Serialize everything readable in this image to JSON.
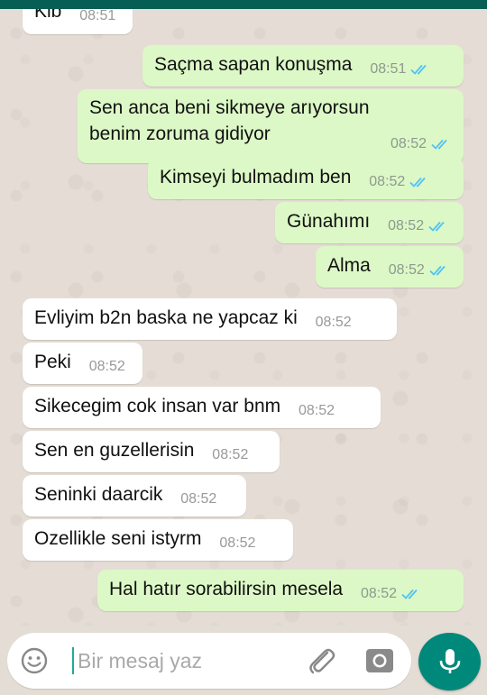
{
  "messages": [
    {
      "dir": "in",
      "text": "Kib",
      "time": "08:51",
      "read": false
    },
    {
      "dir": "out",
      "text": "Saçma sapan konuşma",
      "time": "08:51",
      "read": true
    },
    {
      "dir": "out",
      "text": "Sen anca beni sikmeye arıyorsun benim zoruma gidiyor",
      "time": "08:52",
      "read": true
    },
    {
      "dir": "out",
      "text": "Kimseyi bulmadım ben",
      "time": "08:52",
      "read": true
    },
    {
      "dir": "out",
      "text": "Günahımı",
      "time": "08:52",
      "read": true
    },
    {
      "dir": "out",
      "text": "Alma",
      "time": "08:52",
      "read": true
    },
    {
      "dir": "in",
      "text": "Evliyim b2n baska ne yapcaz ki",
      "time": "08:52",
      "read": false
    },
    {
      "dir": "in",
      "text": "Peki",
      "time": "08:52",
      "read": false
    },
    {
      "dir": "in",
      "text": "Sikecegim cok insan var bnm",
      "time": "08:52",
      "read": false
    },
    {
      "dir": "in",
      "text": "Sen en guzellerisin",
      "time": "08:52",
      "read": false
    },
    {
      "dir": "in",
      "text": "Seninki daarcik",
      "time": "08:52",
      "read": false
    },
    {
      "dir": "in",
      "text": "Ozellikle seni istyrm",
      "time": "08:52",
      "read": false
    },
    {
      "dir": "out",
      "text": "Hal hatır sorabilirsin mesela",
      "time": "08:52",
      "read": true
    }
  ],
  "input": {
    "placeholder": "Bir mesaj yaz"
  },
  "icons": {
    "emoji": "emoji-icon",
    "attach": "paperclip-icon",
    "camera": "camera-icon",
    "mic": "microphone-icon",
    "read_receipt": "double-check-icon"
  },
  "colors": {
    "header": "#075e54",
    "outgoing_bubble": "#dcf8c6",
    "incoming_bubble": "#ffffff",
    "read_ticks": "#4fc3f7",
    "mic_button": "#00897b",
    "caret": "#1eab97"
  }
}
